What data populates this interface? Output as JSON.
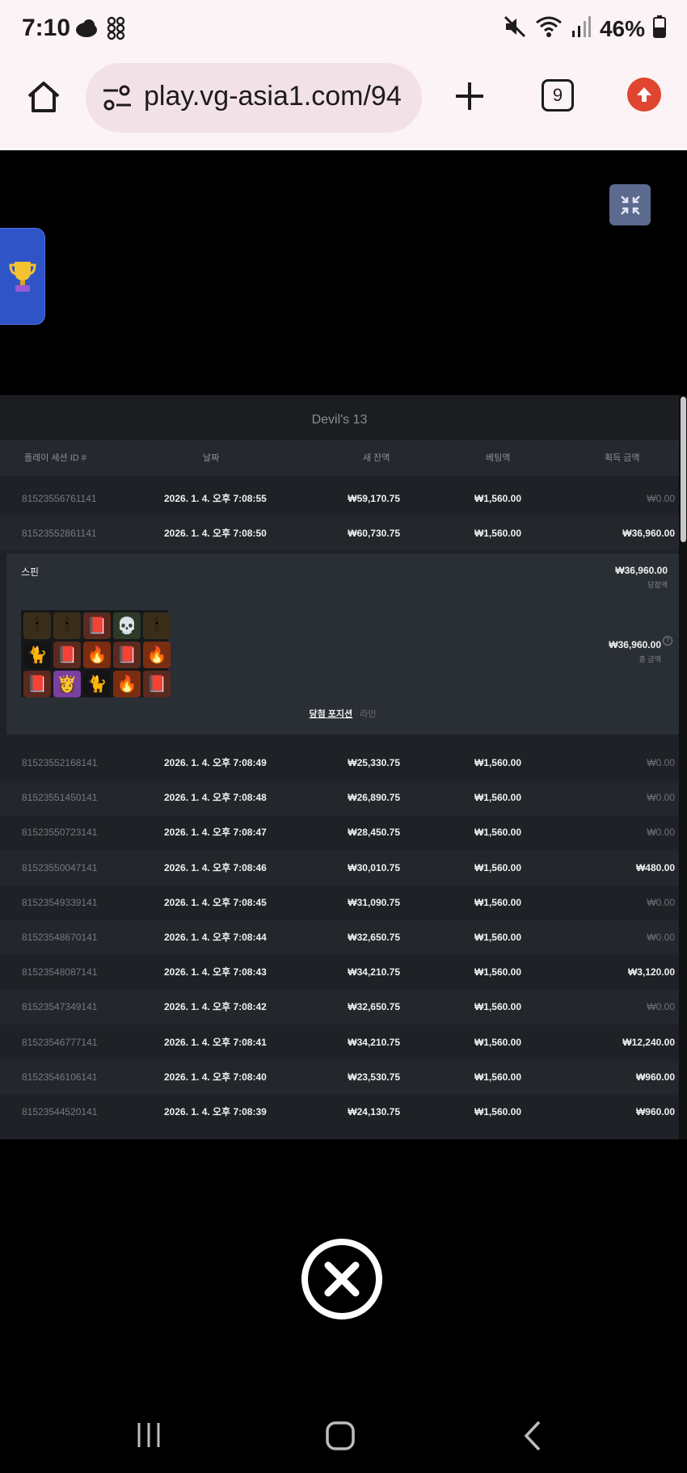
{
  "status_bar": {
    "time": "7:10",
    "battery": "46%",
    "icons": [
      "cloud-icon",
      "apps-grid-icon",
      "mute-icon",
      "wifi-icon",
      "signal-icon",
      "battery-icon"
    ]
  },
  "browser": {
    "url": "play.vg-asia1.com/94",
    "tab_count": "9"
  },
  "panel": {
    "title": "Devil's 13",
    "headers": [
      "플레이 세션 ID #",
      "날짜",
      "새 잔액",
      "베팅액",
      "획득 금액"
    ],
    "rows_top": [
      {
        "id": "81523556761141",
        "date": "2026. 1. 4. 오후 7:08:55",
        "balance": "₩59,170.75",
        "bet": "₩1,560.00",
        "win": "₩0.00"
      },
      {
        "id": "81523552861141",
        "date": "2026. 1. 4. 오후 7:08:50",
        "balance": "₩60,730.75",
        "bet": "₩1,560.00",
        "win": "₩36,960.00"
      }
    ],
    "detail": {
      "label": "스핀",
      "win": "₩36,960.00",
      "win_sub": "당첨액",
      "total": "₩36,960.00",
      "total_sub": "총 금액",
      "tab_active": "당첨 포지션",
      "tab_inactive": "라인"
    },
    "rows": [
      {
        "id": "81523552168141",
        "date": "2026. 1. 4. 오후 7:08:49",
        "balance": "₩25,330.75",
        "bet": "₩1,560.00",
        "win": "₩0.00"
      },
      {
        "id": "81523551450141",
        "date": "2026. 1. 4. 오후 7:08:48",
        "balance": "₩26,890.75",
        "bet": "₩1,560.00",
        "win": "₩0.00"
      },
      {
        "id": "81523550723141",
        "date": "2026. 1. 4. 오후 7:08:47",
        "balance": "₩28,450.75",
        "bet": "₩1,560.00",
        "win": "₩0.00"
      },
      {
        "id": "81523550047141",
        "date": "2026. 1. 4. 오후 7:08:46",
        "balance": "₩30,010.75",
        "bet": "₩1,560.00",
        "win": "₩480.00"
      },
      {
        "id": "81523549339141",
        "date": "2026. 1. 4. 오후 7:08:45",
        "balance": "₩31,090.75",
        "bet": "₩1,560.00",
        "win": "₩0.00"
      },
      {
        "id": "81523548670141",
        "date": "2026. 1. 4. 오후 7:08:44",
        "balance": "₩32,650.75",
        "bet": "₩1,560.00",
        "win": "₩0.00"
      },
      {
        "id": "81523548087141",
        "date": "2026. 1. 4. 오후 7:08:43",
        "balance": "₩34,210.75",
        "bet": "₩1,560.00",
        "win": "₩3,120.00"
      },
      {
        "id": "81523547349141",
        "date": "2026. 1. 4. 오후 7:08:42",
        "balance": "₩32,650.75",
        "bet": "₩1,560.00",
        "win": "₩0.00"
      },
      {
        "id": "81523546777141",
        "date": "2026. 1. 4. 오후 7:08:41",
        "balance": "₩34,210.75",
        "bet": "₩1,560.00",
        "win": "₩12,240.00"
      },
      {
        "id": "81523546106141",
        "date": "2026. 1. 4. 오후 7:08:40",
        "balance": "₩23,530.75",
        "bet": "₩1,560.00",
        "win": "₩960.00"
      },
      {
        "id": "81523544520141",
        "date": "2026. 1. 4. 오후 7:08:39",
        "balance": "₩24,130.75",
        "bet": "₩1,560.00",
        "win": "₩960.00"
      }
    ]
  },
  "colors": {
    "accent_blue": "#2f54c7",
    "upload_red": "#e0452f",
    "panel_bg": "#1e2125"
  }
}
